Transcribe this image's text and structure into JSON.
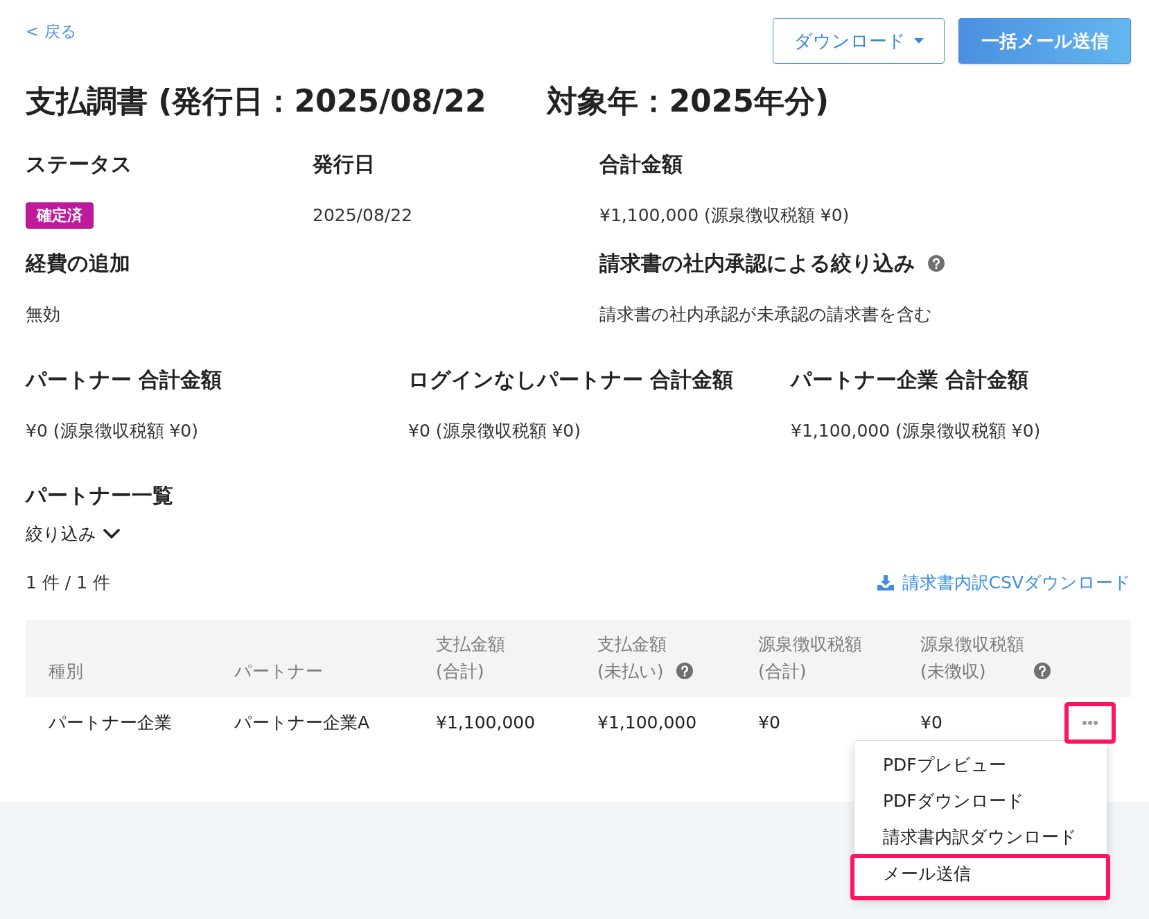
{
  "back_link": {
    "label": "< 戻る"
  },
  "header_buttons": [
    {
      "kind": "dropdown",
      "label": "ダウンロード"
    },
    {
      "kind": "primary",
      "label": "一括メール送信"
    }
  ],
  "title": "支払調書 (発行日：2025/08/22　　対象年：2025年分)",
  "summary_columns": [
    [
      {
        "label": "ステータス",
        "kind": "badge",
        "value": "確定済",
        "help": false
      },
      {
        "label": "経費の追加",
        "kind": "text",
        "value": "無効",
        "help": false
      }
    ],
    [
      {
        "label": "発行日",
        "kind": "text",
        "value": "2025/08/22",
        "help": false
      }
    ],
    [
      {
        "label": "合計金額",
        "kind": "text",
        "value": "¥1,100,000 (源泉徴収税額 ¥0)",
        "help": false
      },
      {
        "label": "請求書の社内承認による絞り込み",
        "kind": "text",
        "value": "請求書の社内承認が未承認の請求書を含む",
        "help": true
      }
    ]
  ],
  "partner_totals": [
    {
      "label": "パートナー 合計金額",
      "value": "¥0 (源泉徴収税額 ¥0)"
    },
    {
      "label": "ログインなしパートナー 合計金額",
      "value": "¥0 (源泉徴収税額 ¥0)"
    },
    {
      "label": "パートナー企業 合計金額",
      "value": "¥1,100,000 (源泉徴収税額 ¥0)"
    }
  ],
  "partner_list": {
    "title": "パートナー一覧",
    "filter": {
      "label": "絞り込み",
      "expanded": false
    },
    "count": "1 件 / 1 件",
    "csv_link": "請求書内訳CSVダウンロード",
    "table": {
      "columns": [
        {
          "label": "種別",
          "help": false
        },
        {
          "label": "パートナー",
          "help": false
        },
        {
          "label": "支払金額\n(合計)",
          "help": false
        },
        {
          "label": "支払金額\n(未払い)",
          "help": true
        },
        {
          "label": "源泉徴収税額\n(合計)",
          "help": false
        },
        {
          "label": "源泉徴収税額\n(未徴収)",
          "help": true
        }
      ],
      "rows": [
        {
          "cells": [
            "パートナー企業",
            "パートナー企業A",
            "¥1,100,000",
            "¥1,100,000",
            "¥0",
            "¥0"
          ],
          "actions": {
            "highlighted": true,
            "menu_open": true,
            "menu": [
              {
                "label": "PDFプレビュー",
                "highlighted": false
              },
              {
                "label": "PDFダウンロード",
                "highlighted": false
              },
              {
                "label": "請求書内訳ダウンロード",
                "highlighted": false
              },
              {
                "label": "メール送信",
                "highlighted": true
              }
            ]
          }
        }
      ]
    }
  }
}
